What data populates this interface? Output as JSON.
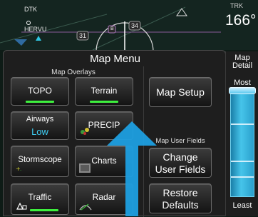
{
  "map": {
    "dtk_label": "DTK",
    "waypoint_label": "HERVU",
    "trk_label": "TRK",
    "trk_value": "166°",
    "airway_31": "31",
    "airway_34": "34",
    "marker_b": "B"
  },
  "menu": {
    "title": "Map Menu",
    "overlays_title": "Map Overlays",
    "user_fields_title": "Map User Fields",
    "buttons": {
      "topo": "TOPO",
      "terrain": "Terrain",
      "airways": "Airways",
      "airways_value": "Low",
      "precip": "PRECIP",
      "stormscope": "Stormscope",
      "charts": "Charts",
      "traffic": "Traffic",
      "radar": "Radar",
      "map_setup": "Map Setup",
      "change_user_fields_1": "Change",
      "change_user_fields_2": "User Fields",
      "restore_defaults_1": "Restore",
      "restore_defaults_2": "Defaults"
    }
  },
  "detail": {
    "title_1": "Map",
    "title_2": "Detail",
    "most": "Most",
    "least": "Least",
    "level": 1.0
  },
  "colors": {
    "active_bar": "#3ef03e",
    "accent_cyan": "#3ecff5",
    "arrow": "#1e9fe0"
  }
}
